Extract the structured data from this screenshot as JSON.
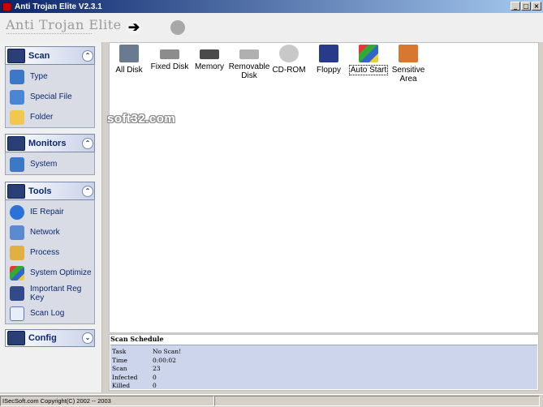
{
  "window": {
    "title": "Anti Trojan Elite V2.3.1",
    "minimize": "_",
    "maximize": "□",
    "close": "×"
  },
  "header": {
    "logo": "Anti Trojan Elite"
  },
  "sidebar": {
    "groups": [
      {
        "title": "Scan",
        "items": [
          "Type",
          "Special File",
          "Folder"
        ]
      },
      {
        "title": "Monitors",
        "items": [
          "System"
        ]
      },
      {
        "title": "Tools",
        "items": [
          "IE Repair",
          "Network",
          "Process",
          "System Optimize",
          "Important Reg Key",
          "Scan Log"
        ]
      },
      {
        "title": "Config",
        "items": []
      }
    ]
  },
  "main": {
    "items": [
      "All Disk",
      "Fixed Disk",
      "Memory",
      "Removable Disk",
      "CD-ROM",
      "Floppy",
      "Auto Start",
      "Sensitive Area"
    ]
  },
  "watermark": "soft32.com",
  "schedule": {
    "title": "Scan Schedule",
    "rows": [
      {
        "k": "Task",
        "v": "No Scan!"
      },
      {
        "k": "Time",
        "v": "0:00:02"
      },
      {
        "k": "Scan",
        "v": "23"
      },
      {
        "k": "Infected",
        "v": "0"
      },
      {
        "k": "Killed",
        "v": "0"
      }
    ]
  },
  "status": {
    "text": "ISecSoft.com  Copyright(C) 2002 -- 2003"
  },
  "colors": {
    "titlebar": "#0a246a",
    "sidebar_text": "#0a2870",
    "schedule_bg": "#cdd5ec"
  }
}
